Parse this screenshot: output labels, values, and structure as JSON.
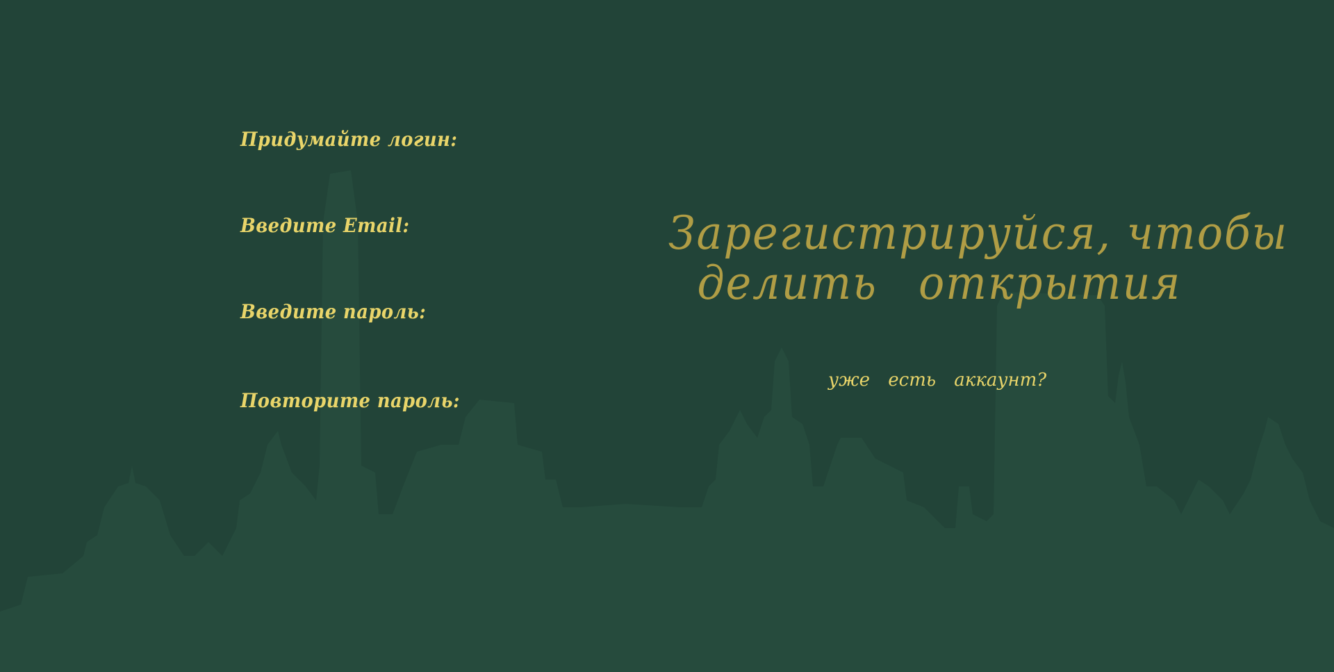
{
  "colors": {
    "background": "#224438",
    "skyline": "#264b3d",
    "label": "#e9d56a",
    "headline": "#b09d45",
    "link": "#e9d56a"
  },
  "form": {
    "login_label": "Придумайте логин:",
    "email_label": "Введите Email:",
    "password_label": "Введите пароль:",
    "repeat_password_label": "Повторите пароль:"
  },
  "headline": {
    "line1": "Зарегистрируйся, чтобы",
    "line2": "делить открытия"
  },
  "login_link": "уже есть аккаунт?"
}
